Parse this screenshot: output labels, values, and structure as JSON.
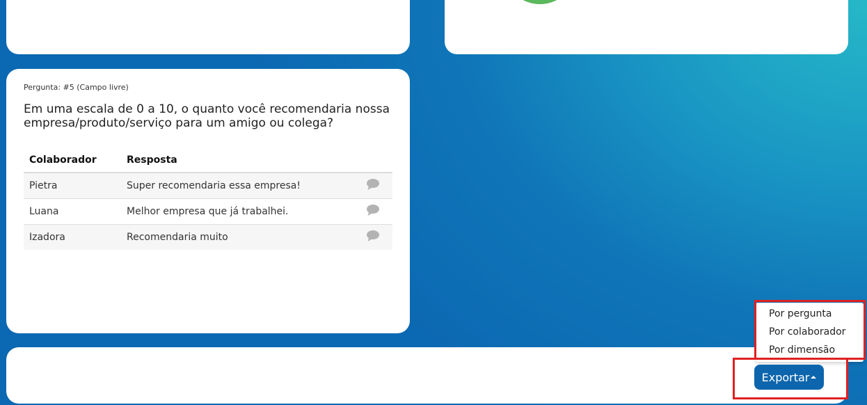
{
  "question": {
    "meta": "Pergunta: #5 (Campo livre)",
    "text": "Em uma escala de 0 a 10, o quanto você recomendaria nossa empresa/produto/serviço para um amigo ou colega?",
    "columns": [
      "Colaborador",
      "Resposta"
    ],
    "rows": [
      {
        "name": "Pietra",
        "answer": "Super recomendaria essa empresa!"
      },
      {
        "name": "Luana",
        "answer": "Melhor empresa que já trabalhei."
      },
      {
        "name": "Izadora",
        "answer": "Recomendaria muito"
      }
    ],
    "row_icon": "comment-icon"
  },
  "export": {
    "button_label": "Exportar",
    "button_icon": "caret-up-icon",
    "menu_items": [
      "Por pergunta",
      "Por colaborador",
      "Por dimensão"
    ]
  },
  "colors": {
    "accent": "#0d66ad",
    "highlight": "#e02020",
    "chart_green": "#5cb85c"
  }
}
